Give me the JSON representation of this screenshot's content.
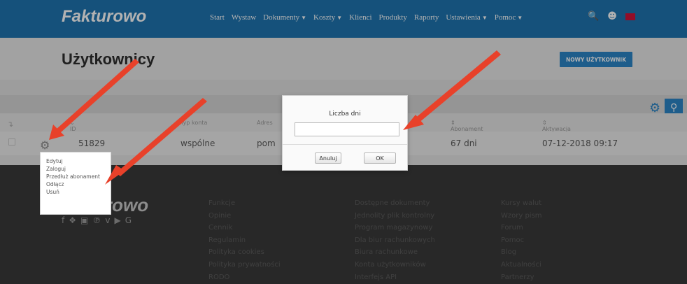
{
  "nav": {
    "logo": "Fakturowo",
    "items": [
      "Start",
      "Wystaw",
      "Dokumenty",
      "Koszty",
      "Klienci",
      "Produkty",
      "Raporty",
      "Ustawienia",
      "Pomoc"
    ],
    "dropdown_flags": [
      false,
      false,
      true,
      true,
      false,
      false,
      false,
      true,
      true
    ],
    "icons": [
      "search-icon",
      "user-icon",
      "flag-icon"
    ]
  },
  "header": {
    "title": "Użytkownicy",
    "new_user_button": "NOWY UŻYTKOWNIK"
  },
  "table": {
    "columns": [
      "ID użytkownika",
      "Typ konta",
      "Adres",
      "Abonament",
      "Aktywacja"
    ],
    "rows": [
      {
        "id": "51829",
        "type": "wspólne",
        "address": "pom",
        "subscription": "67 dni",
        "activation": "07-12-2018 09:17"
      }
    ]
  },
  "context_menu": {
    "items": [
      "Edytuj",
      "Zaloguj",
      "Przedłuż abonament",
      "Odłącz",
      "Usuń"
    ]
  },
  "dialog": {
    "title": "Liczba dni",
    "input_value": "",
    "cancel_label": "Anuluj",
    "ok_label": "OK"
  },
  "footer": {
    "logo_text": "rowo",
    "social_icons": [
      "facebook-icon",
      "twitter-icon",
      "instagram-icon",
      "pinterest-icon",
      "vimeo-icon",
      "youtube-icon",
      "google-icon"
    ],
    "col1": [
      "Funkcje",
      "Opinie",
      "Cennik",
      "Regulamin",
      "Polityka cookies",
      "Polityka prywatności",
      "RODO"
    ],
    "col2": [
      "Dostępne dokumenty",
      "Jednolity plik kontrolny",
      "Program magazynowy",
      "Dla biur rachunkowych",
      "Biura rachunkowe",
      "Konta użytkowników",
      "Interfejs API"
    ],
    "col3": [
      "Kursy walut",
      "Wzory pism",
      "Forum",
      "Pomoc",
      "Blog",
      "Aktualności",
      "Partnerzy"
    ]
  },
  "colors": {
    "brand_blue": "#1f74b0",
    "button_blue": "#2b86c8",
    "arrow_red": "#e8412a"
  }
}
